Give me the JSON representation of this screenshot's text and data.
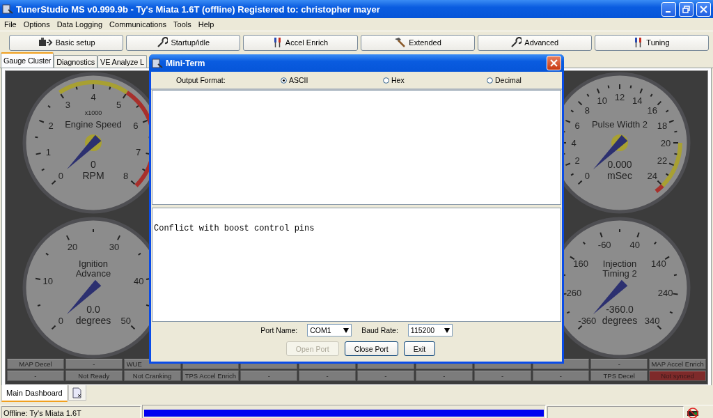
{
  "window": {
    "title": "TunerStudio MS v0.999.9b - Ty's Miata 1.6T (offline) Registered to: christopher mayer"
  },
  "menu": [
    "File",
    "Options",
    "Data Logging",
    "Communications",
    "Tools",
    "Help"
  ],
  "toolbar": [
    {
      "label": "Basic setup",
      "kind": "motor"
    },
    {
      "label": "Startup/idle",
      "kind": "wrench"
    },
    {
      "label": "Accel Enrich",
      "kind": "screwdrivers"
    },
    {
      "label": "Extended",
      "kind": "hammer"
    },
    {
      "label": "Advanced",
      "kind": "wrench"
    },
    {
      "label": "Tuning",
      "kind": "screwdrivers"
    }
  ],
  "tabs": [
    {
      "label": "Gauge Cluster",
      "selected": true
    },
    {
      "label": "Diagnostics",
      "selected": false
    },
    {
      "label": "VE Analyze L",
      "selected": false
    }
  ],
  "dashboard": {
    "gauges": [
      {
        "title": "Engine Speed",
        "scale": "x1000",
        "value": "0",
        "unit": "RPM",
        "hub": true,
        "labels": [
          {
            "text": "0"
          },
          {
            "text": "1"
          },
          {
            "text": "2"
          },
          {
            "text": "3",
            "color": "#a8a032"
          },
          {
            "text": "4",
            "color": "#a8a032"
          },
          {
            "text": "5",
            "color": "#a8302c"
          },
          {
            "text": "6",
            "color": "#a8302c"
          },
          {
            "text": "7",
            "color": "#a8302c"
          },
          {
            "text": "8"
          }
        ]
      },
      {
        "title": "Pulse Width 2",
        "value": "0.000",
        "unit": "mSec",
        "hub": true,
        "labels": [
          {
            "text": "0"
          },
          {
            "text": "2"
          },
          {
            "text": "4"
          },
          {
            "text": "6"
          },
          {
            "text": "8"
          },
          {
            "text": "10"
          },
          {
            "text": "12"
          },
          {
            "text": "14"
          },
          {
            "text": "16"
          },
          {
            "text": "18"
          },
          {
            "text": "20",
            "color": "#a8a032"
          },
          {
            "text": "22",
            "color": "#a8a032"
          },
          {
            "text": "24",
            "color": "#a8302c"
          }
        ]
      },
      {
        "title": "Ignition Advance",
        "value": "0.0",
        "unit": "degrees",
        "hub": false,
        "labels": [
          {
            "text": "0"
          },
          {
            "text": "10"
          },
          {
            "text": "20"
          },
          {
            "text": "30"
          },
          {
            "text": "40"
          },
          {
            "text": "50"
          }
        ]
      },
      {
        "title": "Injection Timing 2",
        "value": "-360.0",
        "unit": "degrees",
        "hub": false,
        "labels": [
          {
            "text": "-360"
          },
          {
            "text": "260"
          },
          {
            "text": "160"
          },
          {
            "text": "-60"
          },
          {
            "text": "40"
          },
          {
            "text": "140"
          },
          {
            "text": "240"
          },
          {
            "text": "340"
          }
        ]
      }
    ],
    "indicators": [
      [
        {
          "label": "MAP Decel",
          "alert": false
        },
        {
          "label": "-",
          "alert": false
        },
        {
          "label": "WUE",
          "alert": false
        },
        {
          "alert": false
        },
        {
          "alert": false
        },
        {
          "alert": false
        },
        {
          "alert": false
        },
        {
          "alert": false
        },
        {
          "alert": false
        },
        {
          "alert": false
        },
        {
          "label": "-",
          "alert": false
        },
        {
          "label": "MAP Accel Enrich",
          "alert": false
        }
      ],
      [
        {
          "label": "-",
          "alert": false
        },
        {
          "label": "Not Ready",
          "alert": false
        },
        {
          "label": "Not Cranking",
          "alert": false
        },
        {
          "label": "TPS Accel Enrich",
          "alert": false
        },
        {
          "label": "-",
          "alert": false
        },
        {
          "label": "-",
          "alert": false
        },
        {
          "label": "-",
          "alert": false
        },
        {
          "label": "-",
          "alert": false
        },
        {
          "label": "-",
          "alert": false
        },
        {
          "label": "-",
          "alert": false
        },
        {
          "label": "TPS Decel",
          "alert": false
        },
        {
          "label": "Not synced",
          "alert": true
        }
      ]
    ]
  },
  "bottom_tabs": [
    {
      "label": "Main Dashboard",
      "selected": true
    }
  ],
  "status_bar": {
    "text": "Offline: Ty's Miata 1.6T",
    "level": 1
  },
  "dialog": {
    "title": "Mini-Term",
    "format_label": "Output Format:",
    "formats": [
      {
        "label": "ASCII",
        "selected": true
      },
      {
        "label": "Hex",
        "selected": false
      },
      {
        "label": "Decimal",
        "selected": false
      }
    ],
    "output": "Conflict with boost control pins",
    "port_label": "Port Name:",
    "port": "COM1",
    "baud_label": "Baud Rate:",
    "baud": "115200",
    "buttons": [
      {
        "label": "Open Port",
        "disabled": true
      },
      {
        "label": "Close Port",
        "disabled": false
      },
      {
        "label": "Exit",
        "disabled": false
      }
    ]
  }
}
